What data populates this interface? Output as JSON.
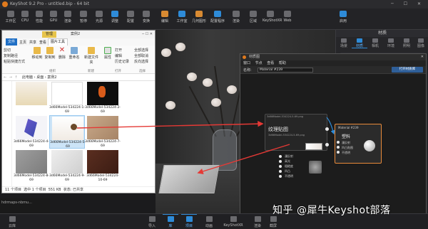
{
  "app": {
    "title": "KeyShot 9.2 Pro - untitled.bip - 64 bit"
  },
  "ribbon": {
    "items": [
      "工作区",
      "CPU",
      "性能",
      "GPU",
      "渲染",
      "暂停",
      "光源",
      "调整",
      "配置",
      "变换",
      "编辑",
      "工作室",
      "几何图形",
      "配置程序",
      "渲染",
      "区域",
      "KeyShotXR",
      "Web",
      "渲染",
      "截屏",
      "导入",
      "库",
      "项目",
      "动画",
      "KeyShotXR",
      "渲染"
    ],
    "right_items": [
      "启用",
      "保存",
      "显示",
      "选项"
    ]
  },
  "right_panel": {
    "title": "材质",
    "tabs": [
      "场景",
      "材质",
      "相机",
      "环境",
      "照明",
      "图像"
    ]
  },
  "explorer": {
    "title": "案例2",
    "manage_label": "管理",
    "tabs": [
      "文件",
      "主页",
      "共享",
      "查看",
      "图片工具"
    ],
    "ribbon": {
      "clip_cut": "剪切",
      "clip_copy_path": "复制路径",
      "clip_paste_shortcut": "粘贴快捷方式",
      "move_to": "移动到",
      "copy_to": "复制到",
      "delete": "删除",
      "rename": "重命名",
      "new_folder": "新建文件夹",
      "properties": "属性",
      "open": "打开",
      "edit": "编辑",
      "history": "历史记录",
      "select_all": "全部选择",
      "select_none": "全部取消",
      "invert": "反向选择",
      "group_organize": "组织",
      "group_new": "新建",
      "group_open": "打开",
      "group_select": "选择"
    },
    "address": [
      "此电脑",
      "桌面",
      "案例2"
    ],
    "tiles": [
      {
        "caption": "",
        "id": "t0"
      },
      {
        "caption": "3d66Model-534224-1-69",
        "id": "t1"
      },
      {
        "caption": "3d66Model-534224-2-69",
        "id": "t2"
      },
      {
        "caption": "3d66Model-534224-4-69",
        "id": "t3"
      },
      {
        "caption": "3d66Model-534224-5-69",
        "id": "t4"
      },
      {
        "caption": "3d66Model-534224-7-69",
        "id": "t5"
      },
      {
        "caption": "3d66Model-534224-8-69",
        "id": "t6"
      },
      {
        "caption": "3d66Model-534224-9-69",
        "id": "t7"
      },
      {
        "caption": "3d66Model-534224-10-69",
        "id": "t8"
      }
    ],
    "status": {
      "count": "11 个项目",
      "selected": "选中 1 个项目",
      "size": "551 KB",
      "state": "状态: 已共享"
    }
  },
  "node_editor": {
    "title": "材质图",
    "menu": [
      "窗口",
      "节点",
      "查看",
      "帮助"
    ],
    "material_label": "名称:",
    "material_name": "Material #239",
    "library_button": "打开材质库",
    "texture_node": {
      "path": "3d66Model-534224-5-69.png",
      "name": "纹理贴图",
      "file": "3d66Model-534224-5-69.png"
    },
    "material_node": {
      "title": "Material #239",
      "kind": "塑料",
      "ports": [
        "漫反射",
        "凹凸贴图",
        "不透明"
      ]
    },
    "prop_node": {
      "labels": [
        "漫反射",
        "高光",
        "粗糙度",
        "凹凸",
        "不透明"
      ]
    }
  },
  "bottom_bar": {
    "items": [
      "云库",
      "导入",
      "库",
      "项目",
      "动画",
      "KeyShotXR",
      "渲染",
      "截屏"
    ],
    "left": "云库"
  },
  "taskbar": {
    "label": "hdrmaps-nbmu..."
  },
  "watermark": "知乎 @犀牛Keyshot部落",
  "colors": {
    "accent": "#2e8bd8",
    "node_border": "#e88a3a",
    "arrow": "#e53935"
  }
}
